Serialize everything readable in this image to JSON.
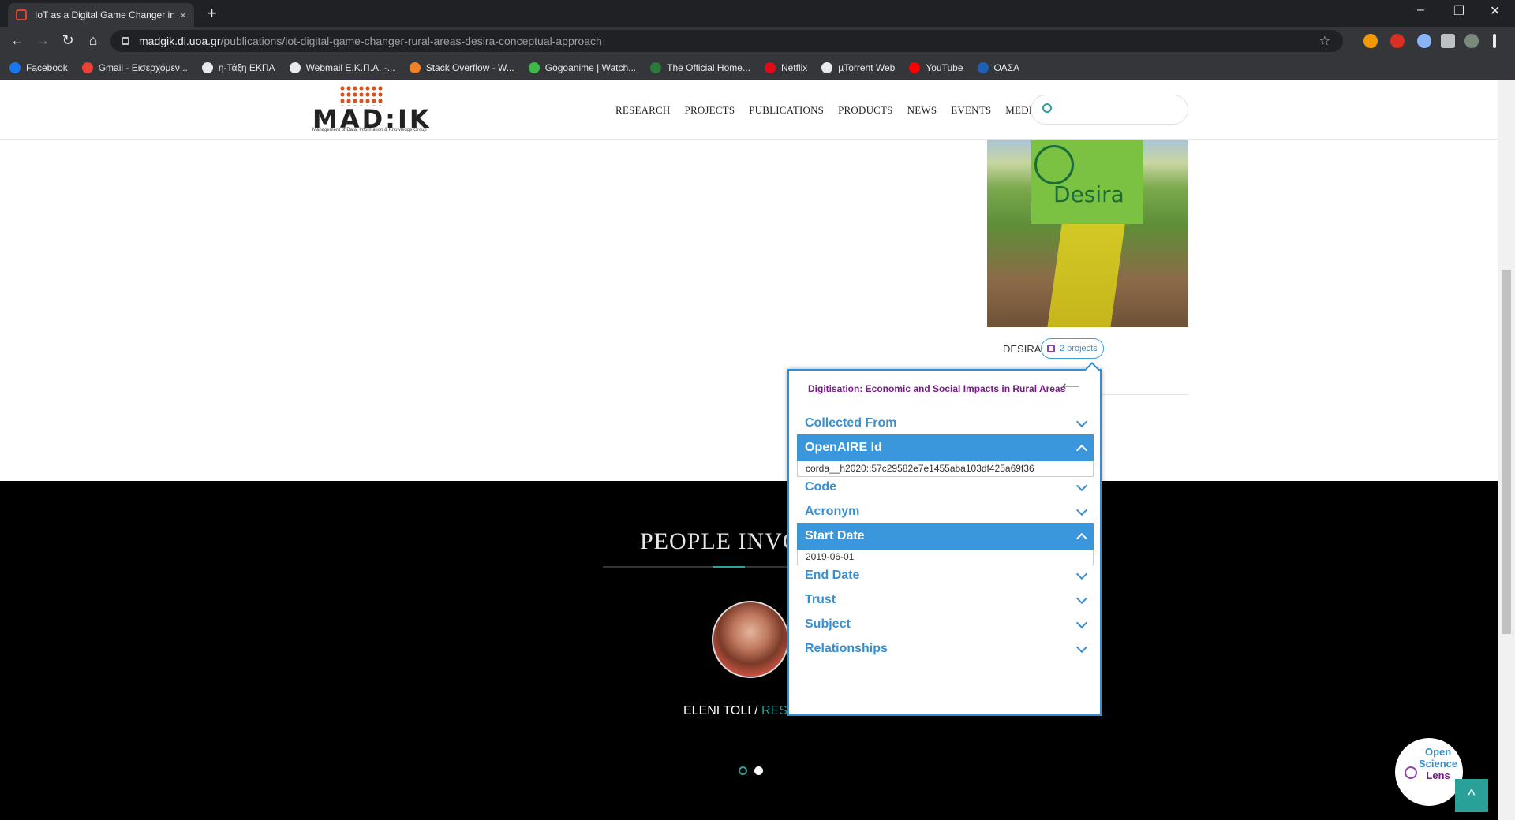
{
  "browser": {
    "tab_title": "IoT as a Digital Game Changer in",
    "tab_close": "×",
    "new_tab": "+",
    "url_host": "madgik.di.uoa.gr",
    "url_path": "/publications/iot-digital-game-changer-rural-areas-desira-conceptual-approach",
    "window_minimize": "–",
    "window_restore": "❐",
    "window_close": "✕",
    "bookmarks": [
      {
        "label": "Facebook",
        "color": "#1877f2"
      },
      {
        "label": "Gmail - Εισερχόμεν...",
        "color": "#ea4335"
      },
      {
        "label": "η-Τάξη ΕΚΠΑ",
        "color": "#e8eaed"
      },
      {
        "label": "Webmail Ε.Κ.Π.Α. -...",
        "color": "#e8eaed"
      },
      {
        "label": "Stack Overflow - W...",
        "color": "#f48024"
      },
      {
        "label": "Gogoanime | Watch...",
        "color": "#3fba4a"
      },
      {
        "label": "The Official Home...",
        "color": "#2c7a3a"
      },
      {
        "label": "Netflix",
        "color": "#e50914"
      },
      {
        "label": "µTorrent Web",
        "color": "#e8eaed"
      },
      {
        "label": "YouTube",
        "color": "#ff0000"
      },
      {
        "label": "ΟΑΣΑ",
        "color": "#1e5fb8"
      }
    ]
  },
  "site": {
    "logo_word": "MAD:IK",
    "logo_tagline": "Management of Data, Information & Knowledge Group",
    "nav": [
      "RESEARCH",
      "PROJECTS",
      "PUBLICATIONS",
      "PRODUCTS",
      "NEWS",
      "EVENTS",
      "MEDIA"
    ],
    "search_placeholder": ""
  },
  "project": {
    "image_brand": "Desira",
    "caption": "DESIRA",
    "badge": "2 projects"
  },
  "people": {
    "title": "PEOPLE INVO",
    "person_name": "ELENI TOLI / ",
    "person_role": "RESE"
  },
  "popup": {
    "title": "Digitisation: Economic and Social Impacts in Rural Areas",
    "back": "⟵",
    "sections": [
      {
        "label": "Collected From",
        "open": false
      },
      {
        "label": "OpenAIRE Id",
        "open": true,
        "value": "corda__h2020::57c29582e7e1455aba103df425a69f36"
      },
      {
        "label": "Code",
        "open": false
      },
      {
        "label": "Acronym",
        "open": false
      },
      {
        "label": "Start Date",
        "open": true,
        "value": "2019-06-01"
      },
      {
        "label": "End Date",
        "open": false
      },
      {
        "label": "Trust",
        "open": false
      },
      {
        "label": "Subject",
        "open": false
      },
      {
        "label": "Relationships",
        "open": false
      }
    ]
  },
  "widget": {
    "line1": "Open",
    "line2": "Science",
    "line3": "Lens",
    "to_top": "^"
  },
  "colors": {
    "accent": "#3a97dc",
    "teal": "#2aa198",
    "purple": "#7a1a8a"
  }
}
